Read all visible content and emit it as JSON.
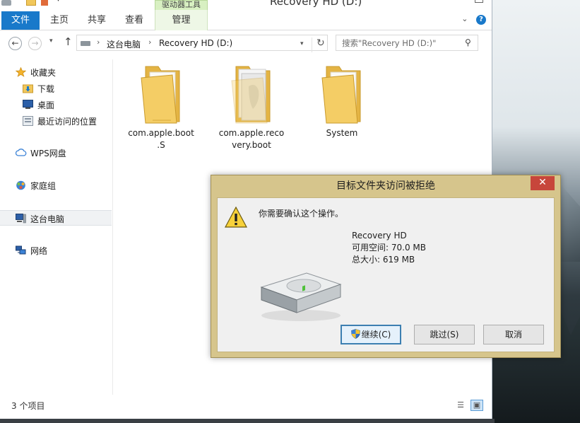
{
  "window": {
    "title": "Recovery HD (D:)",
    "contextual_tab_group": "驱动器工具"
  },
  "ribbon": {
    "tabs": [
      "文件",
      "主页",
      "共享",
      "查看",
      "管理"
    ],
    "collapse_glyph": "⌄",
    "help_glyph": "?"
  },
  "navigation": {
    "back_glyph": "←",
    "forward_glyph": "→",
    "recent_glyph": "▾",
    "up_glyph": "↑",
    "breadcrumb": [
      "这台电脑",
      "Recovery HD (D:)"
    ],
    "refresh_glyph": "↻",
    "search_placeholder": "搜索\"Recovery HD (D:)\""
  },
  "sidebar": {
    "items": [
      {
        "label": "收藏夹",
        "icon": "star-icon"
      },
      {
        "label": "下载",
        "icon": "downloads-folder-icon"
      },
      {
        "label": "桌面",
        "icon": "desktop-icon"
      },
      {
        "label": "最近访问的位置",
        "icon": "recent-places-icon"
      },
      {
        "label": "WPS网盘",
        "icon": "cloud-icon"
      },
      {
        "label": "家庭组",
        "icon": "homegroup-icon"
      },
      {
        "label": "这台电脑",
        "icon": "computer-icon"
      },
      {
        "label": "网络",
        "icon": "network-icon"
      }
    ],
    "selected": "这台电脑"
  },
  "content": {
    "files": [
      {
        "name": "com.apple.boot.S",
        "label_lines": [
          "com.apple.boot",
          ".S"
        ],
        "icon": "folder-icon"
      },
      {
        "name": "com.apple.recovery.boot",
        "label_lines": [
          "com.apple.reco",
          "very.boot"
        ],
        "icon": "folder-icon"
      },
      {
        "name": "System",
        "label_lines": [
          "System"
        ],
        "icon": "folder-icon"
      }
    ]
  },
  "status_bar": {
    "item_count": "3 个项目",
    "active_view": "large-icons"
  },
  "dialog": {
    "title": "目标文件夹访问被拒绝",
    "close_glyph": "✕",
    "message": "你需要确认这个操作。",
    "drive_name": "Recovery HD",
    "free_space": "可用空间: 70.0 MB",
    "total_size": "总大小: 619 MB",
    "buttons": {
      "continue": "继续(C)",
      "skip": "跳过(S)",
      "cancel": "取消"
    }
  },
  "colors": {
    "file_tab": "#1979ca",
    "dialog_frame": "#d6c58c",
    "close_button": "#c7463b",
    "folder": "#f1c75b"
  }
}
